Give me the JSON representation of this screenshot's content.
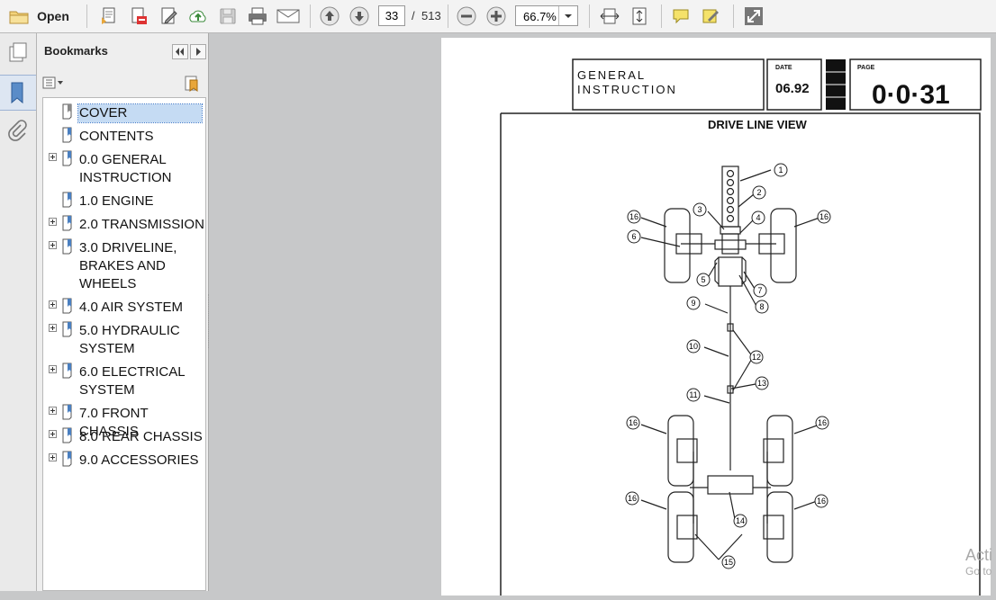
{
  "toolbar": {
    "open_label": "Open",
    "page_current": "33",
    "page_sep": "/",
    "page_total": "513",
    "zoom": "66.7%"
  },
  "bookmarks_panel": {
    "title": "Bookmarks",
    "items": [
      {
        "label": "COVER",
        "expandable": false,
        "selected": true
      },
      {
        "label": "CONTENTS",
        "expandable": false
      },
      {
        "label": "0.0 GENERAL INSTRUCTION",
        "expandable": true
      },
      {
        "label": "1.0 ENGINE",
        "expandable": false
      },
      {
        "label": "2.0 TRANSMISSION",
        "expandable": true
      },
      {
        "label": "3.0 DRIVELINE, BRAKES AND WHEELS",
        "expandable": true
      },
      {
        "label": "4.0 AIR SYSTEM",
        "expandable": true
      },
      {
        "label": "5.0 HYDRAULIC SYSTEM",
        "expandable": true
      },
      {
        "label": "6.0 ELECTRICAL SYSTEM",
        "expandable": true
      },
      {
        "label": "7.0 FRONT CHASSIS",
        "expandable": true
      },
      {
        "label": "8.0 REAR CHASSIS",
        "expandable": true
      },
      {
        "label": "9.0 ACCESSORIES",
        "expandable": true
      }
    ]
  },
  "document": {
    "header_title_line1": "GENERAL",
    "header_title_line2": "INSTRUCTION",
    "date_label": "DATE",
    "date_value": "06.92",
    "page_label": "PAGE",
    "page_value": "0·0·31",
    "diagram_title": "DRIVE LINE VIEW",
    "callouts": [
      "1",
      "2",
      "3",
      "4",
      "5",
      "6",
      "7",
      "8",
      "9",
      "10",
      "11",
      "12",
      "13",
      "14",
      "15",
      "16"
    ]
  },
  "watermark": {
    "line1": "Acti",
    "line2": "Go to"
  },
  "colors": {
    "selection": "#c5dbf3",
    "selection_border": "#3d77c7",
    "toolbar_bg": "#f3f3f3",
    "viewer_bg": "#c7c8c9"
  }
}
